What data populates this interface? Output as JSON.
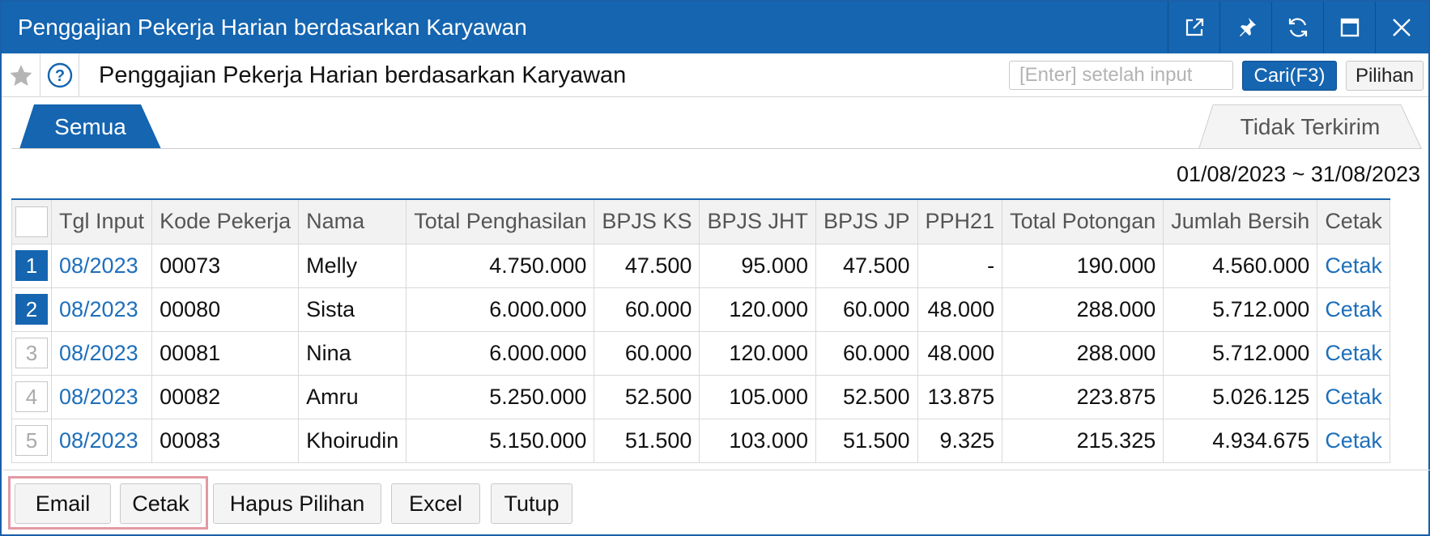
{
  "window": {
    "title": "Penggajian Pekerja Harian berdasarkan Karyawan",
    "controls": [
      "external-link-icon",
      "pin-icon",
      "refresh-icon",
      "maximize-icon",
      "close-icon"
    ],
    "accent_color": "#1565b0"
  },
  "toolbar": {
    "page_title": "Penggajian Pekerja Harian berdasarkan Karyawan",
    "search_placeholder": "[Enter] setelah input",
    "search_value": "",
    "search_button": "Cari(F3)",
    "options_button": "Pilihan"
  },
  "tabs": [
    {
      "label": "Semua",
      "active": true
    },
    {
      "label": "Tidak Terkirim",
      "active": false
    }
  ],
  "date_range": "01/08/2023 ~ 31/08/2023",
  "table": {
    "columns": [
      "Tgl Input",
      "Kode Pekerja",
      "Nama",
      "Total Penghasilan",
      "BPJS KS",
      "BPJS JHT",
      "BPJS JP",
      "PPH21",
      "Total Potongan",
      "Jumlah Bersih",
      "Cetak"
    ],
    "rows": [
      {
        "no": "1",
        "selected": true,
        "tgl": "08/2023",
        "kode": "00073",
        "nama": "Melly",
        "total_penghasilan": "4.750.000",
        "bpjs_ks": "47.500",
        "bpjs_jht": "95.000",
        "bpjs_jp": "47.500",
        "pph21": "-",
        "total_potongan": "190.000",
        "jumlah_bersih": "4.560.000",
        "cetak": "Cetak"
      },
      {
        "no": "2",
        "selected": true,
        "tgl": "08/2023",
        "kode": "00080",
        "nama": "Sista",
        "total_penghasilan": "6.000.000",
        "bpjs_ks": "60.000",
        "bpjs_jht": "120.000",
        "bpjs_jp": "60.000",
        "pph21": "48.000",
        "total_potongan": "288.000",
        "jumlah_bersih": "5.712.000",
        "cetak": "Cetak"
      },
      {
        "no": "3",
        "selected": false,
        "tgl": "08/2023",
        "kode": "00081",
        "nama": "Nina",
        "total_penghasilan": "6.000.000",
        "bpjs_ks": "60.000",
        "bpjs_jht": "120.000",
        "bpjs_jp": "60.000",
        "pph21": "48.000",
        "total_potongan": "288.000",
        "jumlah_bersih": "5.712.000",
        "cetak": "Cetak"
      },
      {
        "no": "4",
        "selected": false,
        "tgl": "08/2023",
        "kode": "00082",
        "nama": "Amru",
        "total_penghasilan": "5.250.000",
        "bpjs_ks": "52.500",
        "bpjs_jht": "105.000",
        "bpjs_jp": "52.500",
        "pph21": "13.875",
        "total_potongan": "223.875",
        "jumlah_bersih": "5.026.125",
        "cetak": "Cetak"
      },
      {
        "no": "5",
        "selected": false,
        "tgl": "08/2023",
        "kode": "00083",
        "nama": "Khoirudin",
        "total_penghasilan": "5.150.000",
        "bpjs_ks": "51.500",
        "bpjs_jht": "103.000",
        "bpjs_jp": "51.500",
        "pph21": "9.325",
        "total_potongan": "215.325",
        "jumlah_bersih": "4.934.675",
        "cetak": "Cetak"
      }
    ]
  },
  "footer": {
    "email": "Email",
    "cetak": "Cetak",
    "hapus_pilihan": "Hapus Pilihan",
    "excel": "Excel",
    "tutup": "Tutup",
    "highlight_color": "#e29aa3"
  }
}
